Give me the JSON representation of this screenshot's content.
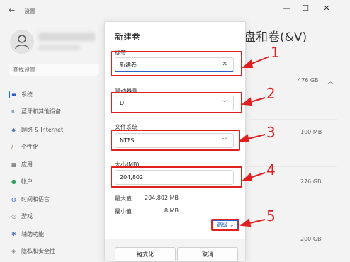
{
  "window": {
    "back_icon": "back-arrow-icon",
    "title": "设置",
    "controls": {
      "minimize": "—",
      "maximize": "☐",
      "close": "✕"
    }
  },
  "sidebar": {
    "search_placeholder": "查找设置",
    "items": [
      {
        "label": "系统",
        "icon": "monitor-icon"
      },
      {
        "label": "蓝牙和其他设备",
        "icon": "bluetooth-icon"
      },
      {
        "label": "网络 & Internet",
        "icon": "wifi-icon"
      },
      {
        "label": "个性化",
        "icon": "brush-icon"
      },
      {
        "label": "应用",
        "icon": "apps-icon"
      },
      {
        "label": "帐户",
        "icon": "person-icon"
      },
      {
        "label": "时间和语言",
        "icon": "globe-icon"
      },
      {
        "label": "游戏",
        "icon": "gamepad-icon"
      },
      {
        "label": "辅助功能",
        "icon": "accessibility-icon"
      },
      {
        "label": "隐私和安全性",
        "icon": "shield-icon"
      }
    ]
  },
  "main": {
    "heading_partial": "盘和卷(&V)",
    "sizes": [
      "476 GB",
      "100 MB",
      "276 GB",
      "200 GB"
    ]
  },
  "dialog": {
    "title": "新建卷",
    "label_field": {
      "label": "标签",
      "value": "新建卷"
    },
    "drive_letter": {
      "label": "驱动器号",
      "value": "D"
    },
    "file_system": {
      "label": "文件系统",
      "value": "NTFS"
    },
    "size": {
      "label": "大小(MB)",
      "value": "204,802"
    },
    "max_label": "最大值:",
    "max_value": "204,802 MB",
    "min_label": "最小值",
    "min_value": "8 MB",
    "advanced": "高级",
    "format_button": "格式化",
    "cancel_button": "取消"
  },
  "annotations": [
    "1",
    "2",
    "3",
    "4",
    "5"
  ],
  "colors": {
    "accent": "#2a62c9",
    "annotation": "#e02020"
  }
}
